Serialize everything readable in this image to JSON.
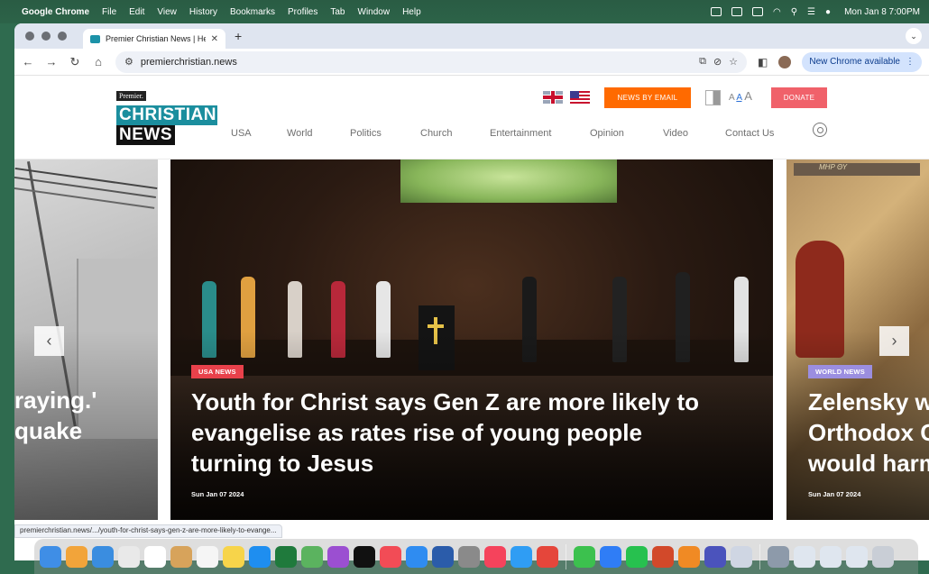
{
  "menubar": {
    "app_name": "Google Chrome",
    "items": [
      "File",
      "Edit",
      "View",
      "History",
      "Bookmarks",
      "Profiles",
      "Tab",
      "Window",
      "Help"
    ],
    "clock": "Mon Jan 8  7:00PM"
  },
  "browser": {
    "tab_title": "Premier Christian News | Hea",
    "url": "premierchristian.news",
    "update_label": "New Chrome available",
    "status_url": "premierchristian.news/.../youth-for-christ-says-gen-z-are-more-likely-to-evange..."
  },
  "site": {
    "logo": {
      "premier": "Premier.",
      "christian": "CHRISTIAN",
      "news": "NEWS"
    },
    "news_by_email": "NEWS BY EMAIL",
    "donate": "DONATE",
    "text_size": {
      "small": "A",
      "medium": "A",
      "large": "A"
    },
    "nav": [
      "USA",
      "World",
      "Politics",
      "Church",
      "Entertainment",
      "Opinion",
      "Video",
      "Contact Us"
    ]
  },
  "slides": {
    "left": {
      "headline_line1": "raying.'",
      "headline_line2": " quake"
    },
    "center": {
      "category": "USA NEWS",
      "category_color": "#e8414b",
      "headline_line1": "Youth for Christ says Gen Z are more likely to",
      "headline_line2": "evangelise as rates rise of young people",
      "headline_line3": "turning to Jesus",
      "date": "Sun Jan 07 2024"
    },
    "right": {
      "banner": "ΜΗΡ ΘΥ",
      "category": "WORLD NEWS",
      "category_color": "#9b8ee0",
      "headline_line1": "Zelensky w",
      "headline_line2": "Orthodox C",
      "headline_line3": "would harm",
      "date": "Sun Jan 07 2024"
    }
  },
  "colors": {
    "brand_teal": "#1b8e9e",
    "email_orange": "#ff6a00",
    "donate_red": "#f0616a"
  }
}
